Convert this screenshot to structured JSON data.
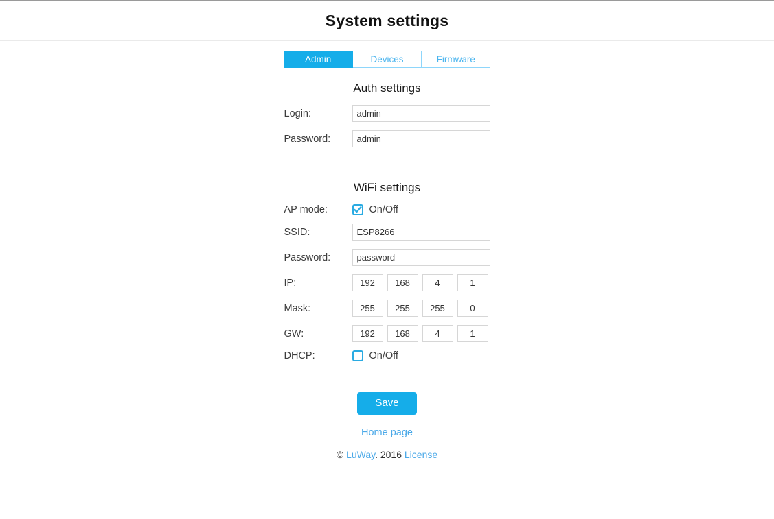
{
  "header": {
    "title": "System settings"
  },
  "tabs": [
    {
      "label": "Admin",
      "active": true
    },
    {
      "label": "Devices",
      "active": false
    },
    {
      "label": "Firmware",
      "active": false
    }
  ],
  "auth": {
    "section_title": "Auth settings",
    "login": {
      "label": "Login:",
      "value": "admin"
    },
    "password": {
      "label": "Password:",
      "value": "admin"
    }
  },
  "wifi": {
    "section_title": "WiFi settings",
    "ap_mode": {
      "label": "AP mode:",
      "toggle_text": "On/Off",
      "checked": true
    },
    "ssid": {
      "label": "SSID:",
      "value": "ESP8266"
    },
    "password": {
      "label": "Password:",
      "value": "password"
    },
    "ip": {
      "label": "IP:",
      "octets": [
        "192",
        "168",
        "4",
        "1"
      ]
    },
    "mask": {
      "label": "Mask:",
      "octets": [
        "255",
        "255",
        "255",
        "0"
      ]
    },
    "gw": {
      "label": "GW:",
      "octets": [
        "192",
        "168",
        "4",
        "1"
      ]
    },
    "dhcp": {
      "label": "DHCP:",
      "toggle_text": "On/Off",
      "checked": false
    }
  },
  "footer": {
    "save_label": "Save",
    "home_link": "Home page",
    "copyright_symbol": "©",
    "copyright_brand": "LuWay",
    "copyright_year": ". 2016 ",
    "license_link": "License"
  },
  "colors": {
    "accent": "#15ade9",
    "link": "#4ba9e8",
    "tab_border": "#8ed6fb",
    "checkbox_border": "#2aabe2",
    "input_border": "#d6d6d6",
    "divider": "#ebebeb"
  }
}
